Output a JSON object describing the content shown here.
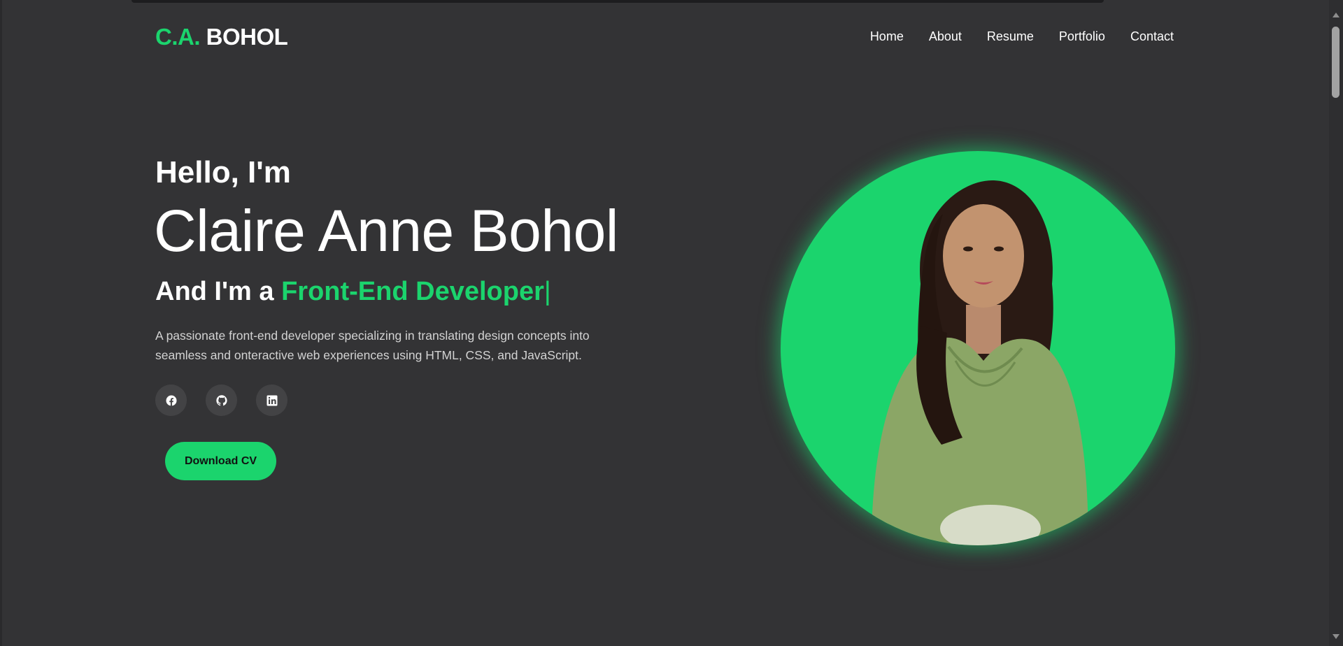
{
  "header": {
    "logo_accent": "C.A.",
    "logo_main": "BOHOL",
    "nav": [
      {
        "label": "Home"
      },
      {
        "label": "About"
      },
      {
        "label": "Resume"
      },
      {
        "label": "Portfolio"
      },
      {
        "label": "Contact"
      }
    ]
  },
  "hero": {
    "greeting": "Hello, I'm",
    "name": "Claire Anne Bohol",
    "role_prefix": "And I'm a",
    "role_highlight": "Front-End Developer",
    "cursor": "|",
    "description": "A passionate front-end developer specializing in translating design concepts into seamless and onteractive web experiences using HTML, CSS, and JavaScript.",
    "social": [
      {
        "icon": "facebook-icon"
      },
      {
        "icon": "github-icon"
      },
      {
        "icon": "linkedin-icon"
      }
    ],
    "cta_label": "Download CV"
  },
  "colors": {
    "accent": "#1bd46d",
    "background": "#333335",
    "social_bg": "#434345",
    "text": "#ffffff",
    "muted_text": "#d3d3d3"
  }
}
